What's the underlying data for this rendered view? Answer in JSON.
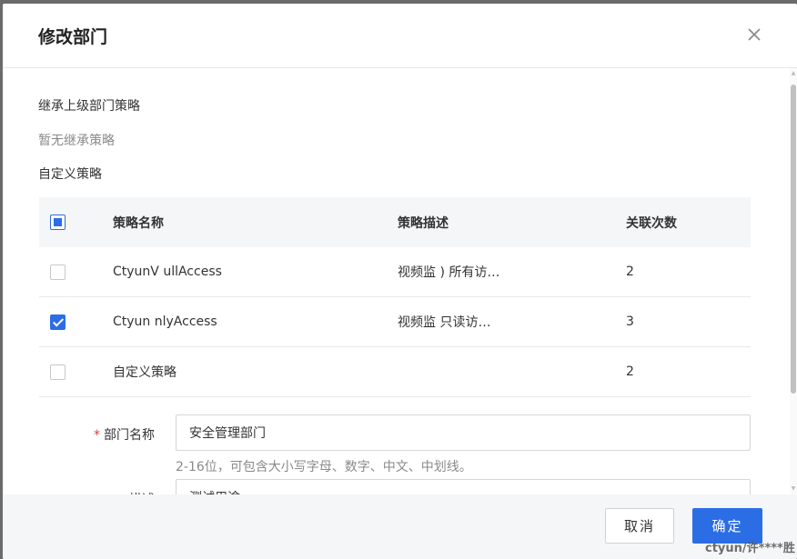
{
  "dialog": {
    "title": "修改部门",
    "close_icon": "close-icon"
  },
  "body": {
    "inherited_label": "继承上级部门策略",
    "inherited_empty": "暂无继承策略",
    "custom_label": "自定义策略"
  },
  "table": {
    "columns": [
      "策略名称",
      "策略描述",
      "关联次数"
    ],
    "header_checkbox": "indeterminate",
    "rows": [
      {
        "name": "CtyunV ullAccess",
        "desc": "视频监   )  所有访…",
        "count": "2",
        "checked": false
      },
      {
        "name": "Ctyun nlyAccess",
        "desc": "视频监   只读访…",
        "count": "3",
        "checked": true
      },
      {
        "name": "自定义策略",
        "desc": "",
        "count": "2",
        "checked": false
      }
    ]
  },
  "form": {
    "dept_name_label": "部门名称",
    "dept_name_value": "安全管理部门",
    "dept_name_hint": "2-16位，可包含大小写字母、数字、中文、中划线。",
    "desc_label": "描述",
    "desc_value": "测试用途"
  },
  "footer": {
    "cancel_label": "取消",
    "confirm_label": "确定"
  },
  "watermark": "ctyun/许****胜",
  "colors": {
    "accent": "#2b6de5",
    "required": "#e53935"
  }
}
